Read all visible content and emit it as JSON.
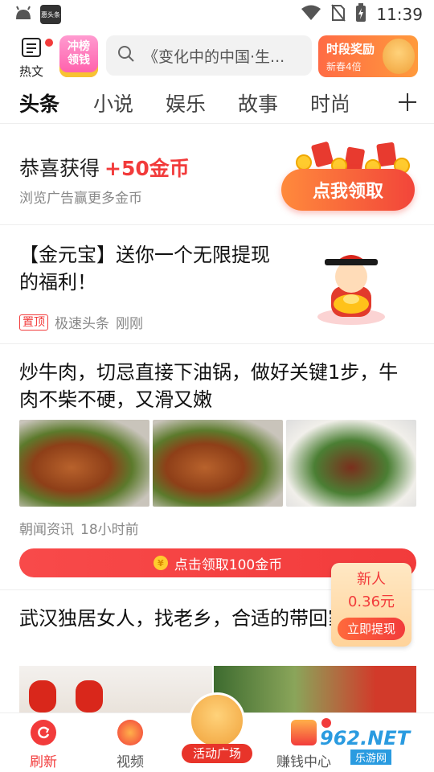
{
  "status_bar": {
    "time": "11:39",
    "app_badge": "惠头条"
  },
  "header": {
    "hot_label": "热文",
    "rank_line1": "冲榜",
    "rank_line2": "领钱",
    "search_placeholder": "《变化中的中国·生...",
    "reward_title": "时段奖励",
    "reward_sub": "新春4倍"
  },
  "tabs": [
    "头条",
    "小说",
    "娱乐",
    "故事",
    "时尚"
  ],
  "coin_banner": {
    "title": "恭喜获得",
    "amount": "+50金币",
    "subtitle": "浏览广告赢更多金币",
    "button": "点我领取"
  },
  "news": [
    {
      "headline": "【金元宝】送你一个无限提现的福利！",
      "pin": "置顶",
      "source": "极速头条",
      "time": "刚刚"
    },
    {
      "headline": "炒牛肉，切忌直接下油锅，做好关键1步，牛肉不柴不硬，又滑又嫩",
      "source": "朝闻资讯",
      "time": "18小时前",
      "coin_bar": "点击领取100金币",
      "coin_symbol": "¥"
    },
    {
      "headline": "武汉独居女人，找老乡，合适的带回家过年"
    }
  ],
  "new_user": {
    "line1": "新人",
    "line2": "0.36元",
    "button": "立即提现"
  },
  "bottom_nav": {
    "refresh": "刷新",
    "video": "视频",
    "activity": "活动广场",
    "earn": "赚钱中心"
  },
  "watermark": {
    "line1": "962.NET",
    "line2": "乐游网"
  }
}
